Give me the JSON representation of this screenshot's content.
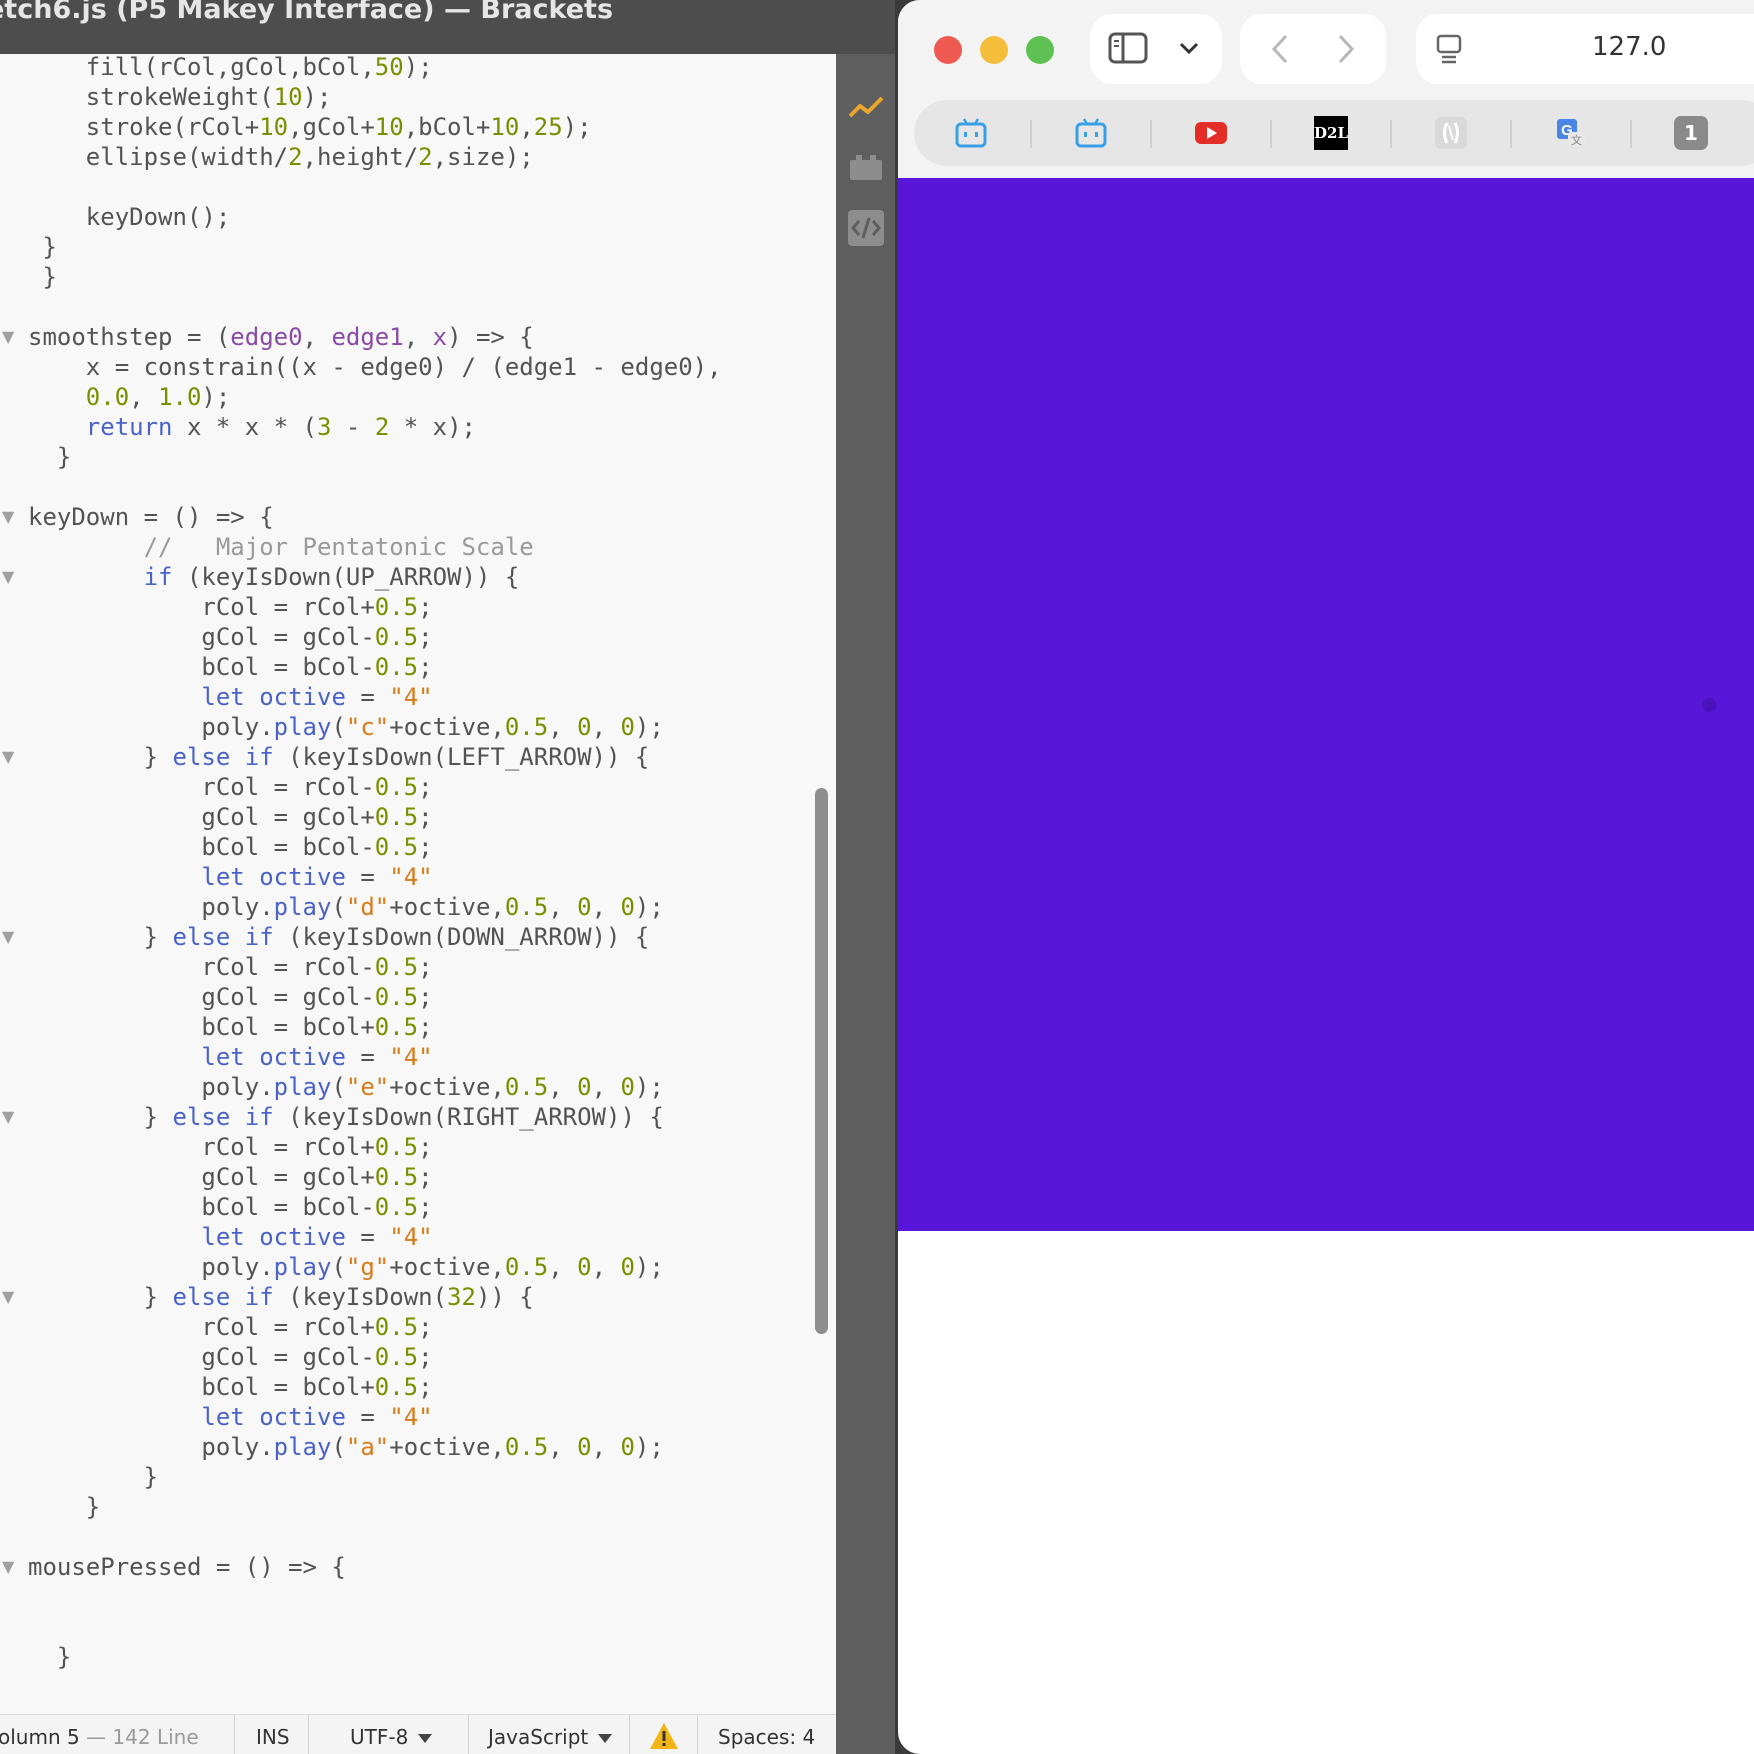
{
  "editor_window": {
    "title": "etch6.js (P5 Makey Interface) — Brackets"
  },
  "code_lines": [
    "    fill(rCol,gCol,bCol,50);",
    "    strokeWeight(10);",
    "    stroke(rCol+10,gCol+10,bCol+10,25);",
    "    ellipse(width/2,height/2,size);",
    "",
    "    keyDown();",
    " }",
    " }",
    "",
    "smoothstep = (edge0, edge1, x) => {",
    "    x = constrain((x - edge0) / (edge1 - edge0),",
    "    0.0, 1.0);",
    "    return x * x * (3 - 2 * x);",
    "  }",
    "",
    "keyDown = () => {",
    "        //   Major Pentatonic Scale",
    "        if (keyIsDown(UP_ARROW)) {",
    "            rCol = rCol+0.5;",
    "            gCol = gCol-0.5;",
    "            bCol = bCol-0.5;",
    "            let octive = \"4\"",
    "            poly.play(\"c\"+octive,0.5, 0, 0);",
    "        } else if (keyIsDown(LEFT_ARROW)) {",
    "            rCol = rCol-0.5;",
    "            gCol = gCol+0.5;",
    "            bCol = bCol-0.5;",
    "            let octive = \"4\"",
    "            poly.play(\"d\"+octive,0.5, 0, 0);",
    "        } else if (keyIsDown(DOWN_ARROW)) {",
    "            rCol = rCol-0.5;",
    "            gCol = gCol-0.5;",
    "            bCol = bCol+0.5;",
    "            let octive = \"4\"",
    "            poly.play(\"e\"+octive,0.5, 0, 0);",
    "        } else if (keyIsDown(RIGHT_ARROW)) {",
    "            rCol = rCol+0.5;",
    "            gCol = gCol+0.5;",
    "            bCol = bCol-0.5;",
    "            let octive = \"4\"",
    "            poly.play(\"g\"+octive,0.5, 0, 0);",
    "        } else if (keyIsDown(32)) {",
    "            rCol = rCol+0.5;",
    "            gCol = gCol-0.5;",
    "            bCol = bCol+0.5;",
    "            let octive = \"4\"",
    "            poly.play(\"a\"+octive,0.5, 0, 0);",
    "        }",
    "    }",
    "",
    "mousePressed = () => {",
    "",
    "",
    "  }"
  ],
  "fold_markers": [
    9,
    15,
    17,
    23,
    29,
    35,
    41,
    50
  ],
  "status_bar": {
    "position": "olumn 5",
    "line_count": "— 142 Line",
    "mode": "INS",
    "encoding": "UTF-8",
    "language": "JavaScript",
    "warning_icon": "warning-triangle-icon",
    "indent": "Spaces:  4"
  },
  "browser": {
    "url_fragment": "127.0",
    "favorites": [
      {
        "icon": "bilibili-icon"
      },
      {
        "icon": "bilibili-icon"
      },
      {
        "icon": "youtube-icon"
      },
      {
        "icon": "d2l-logo",
        "text": "D2L"
      },
      {
        "icon": "bracket-logo-icon"
      },
      {
        "icon": "google-translate-icon"
      },
      {
        "icon": "number-badge-icon",
        "text": "1"
      }
    ],
    "canvas_color": "#5716D8"
  },
  "colors": {
    "keyword": "#4b63c8",
    "number": "#7a8f00",
    "string": "#d97b18",
    "function_param": "#8a4aa8",
    "comment": "#9a9a9a",
    "plain": "#535353"
  }
}
